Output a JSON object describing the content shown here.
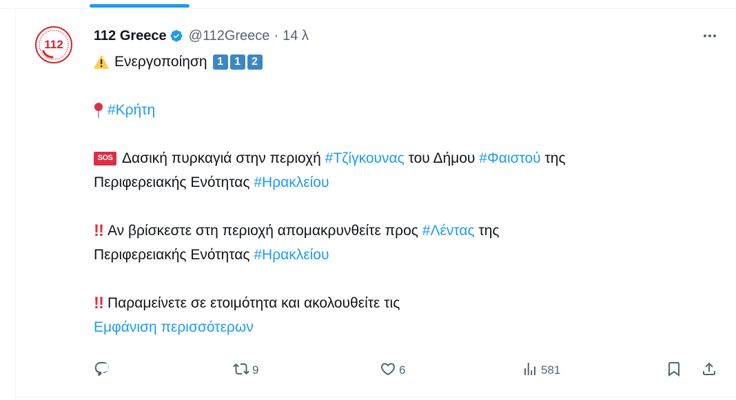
{
  "post": {
    "display_name": "112 Greece",
    "handle": "@112Greece",
    "separator": "·",
    "time": "14 λ",
    "lines": {
      "l1_text": "Ενεργοποίηση",
      "l1_keycaps": [
        "1",
        "1",
        "2"
      ],
      "l2_tag": "#Κρήτη",
      "l3_sos": "SOS",
      "l3_a": "Δασική πυρκαγιά στην περιοχή",
      "l3_tag1": "#Τζίγκουνας",
      "l3_b": "του Δήμου",
      "l3_tag2": "#Φαιστού",
      "l3_c": "της",
      "l4_a": "Περιφερειακής Ενότητας",
      "l4_tag": "#Ηρακλείου",
      "l5_bang": "!!",
      "l5_a": "Αν βρίσκεστε στη περιοχή απομακρυνθείτε προς",
      "l5_tag": "#Λέντας",
      "l5_b": "της",
      "l6_a": "Περιφερειακής Ενότητας",
      "l6_tag": "#Ηρακλείου",
      "l7_bang": "!!",
      "l7_a": "Παραμείνετε σε ετοιμότητα και ακολουθείτε τις"
    },
    "show_more": "Εμφάνιση περισσότερων"
  },
  "avatar_text": "112",
  "actions": {
    "reply_icon": "reply-icon",
    "retweets": "9",
    "likes": "6",
    "views": "581",
    "bookmark_icon": "bookmark-icon",
    "share_icon": "share-icon"
  },
  "colors": {
    "accent": "#1d9bf0",
    "muted": "#536471",
    "text": "#0f1419",
    "avatar_red": "#d8232a"
  }
}
